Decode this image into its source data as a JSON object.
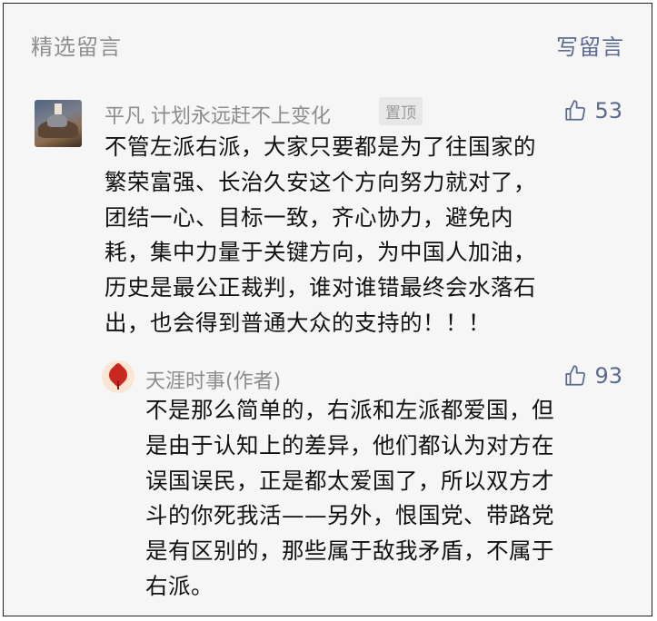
{
  "header": {
    "title": "精选留言",
    "action_label": "写留言"
  },
  "comments": [
    {
      "author": "平凡 计划永远赶不上变化",
      "badge": "置顶",
      "likes": "53",
      "lines": [
        "不管左派右派，大家只要都是为了往国家的",
        "繁荣富强、长治久安这个方向努力就对了，",
        "团结一心、目标一致，齐心协力，避免内",
        "耗，集中力量于关键方向，为中国人加油，",
        "历史是最公正裁判，谁对谁错最终会水落石",
        "出，也会得到普通大众的支持的！！！"
      ],
      "reply": {
        "author": "天涯时事(作者)",
        "likes": "93",
        "lines": [
          "不是那么简单的，右派和左派都爱国，但",
          "是由于认知上的差异，他们都认为对方在",
          "误国误民，正是都太爱国了，所以双方才",
          "斗的你死我活——另外，恨国党、带路党",
          "是有区别的，那些属于敌我矛盾，不属于",
          "右派。"
        ]
      }
    }
  ],
  "icons": {
    "like": "thumbs-up-icon",
    "accent_color": "#5b6b8f"
  }
}
